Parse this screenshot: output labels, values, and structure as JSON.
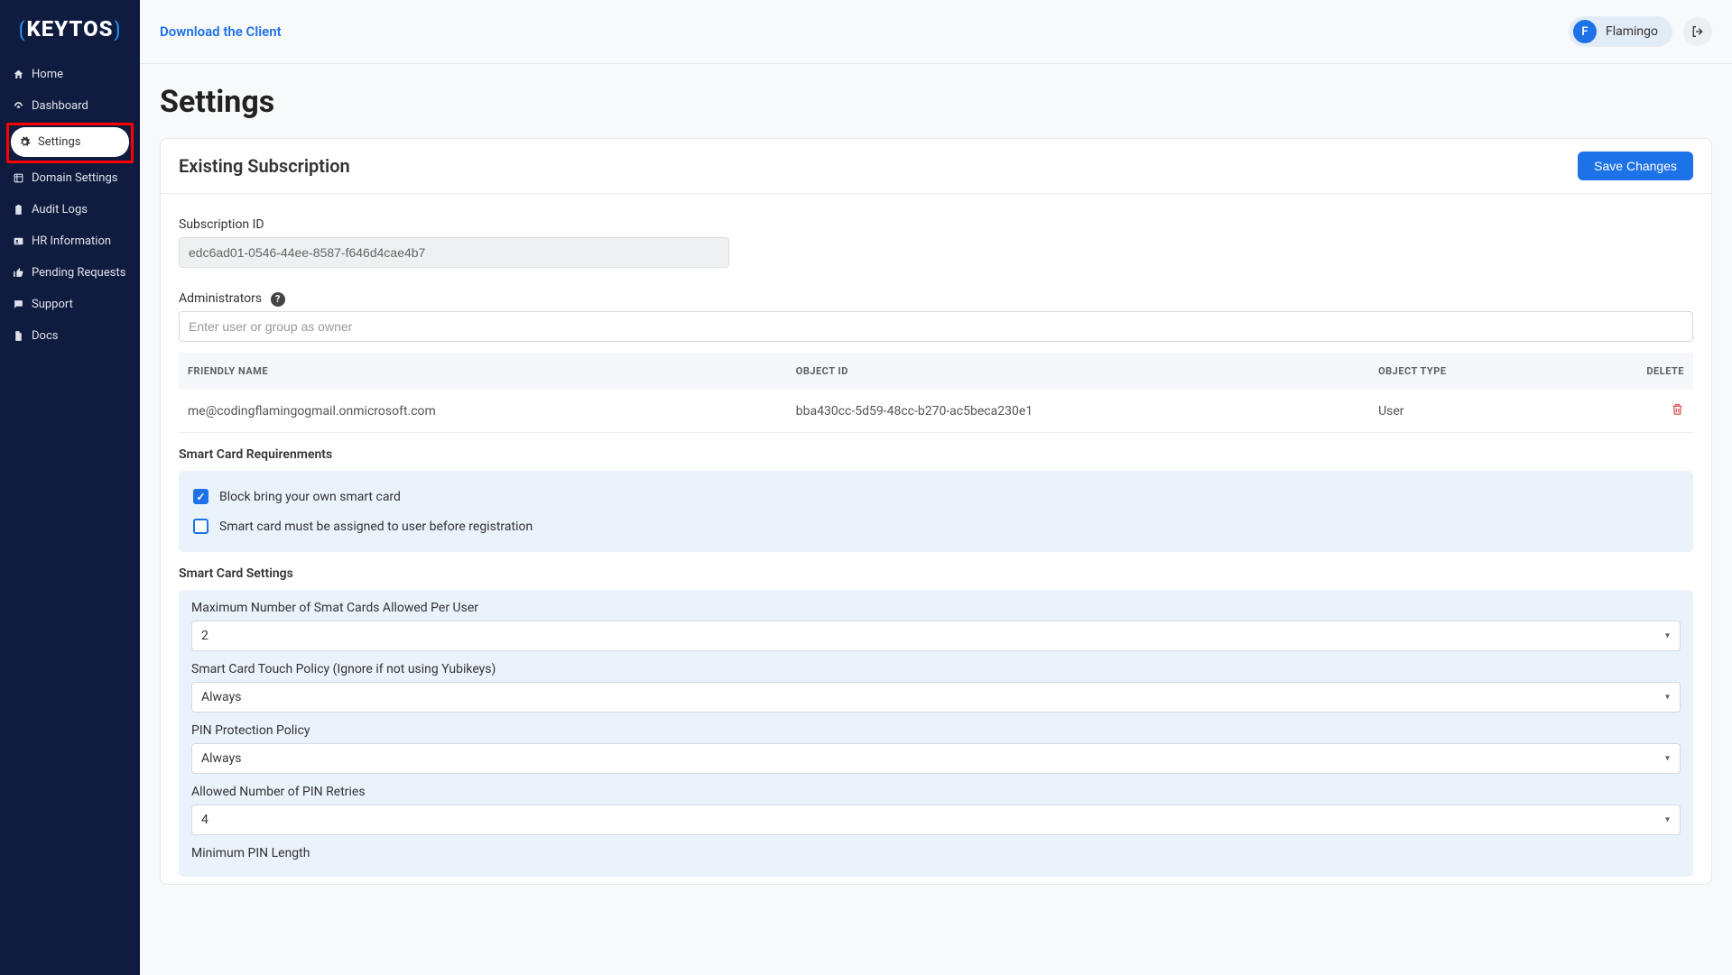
{
  "brand": {
    "name": "KEYTOS"
  },
  "sidebar": {
    "items": [
      {
        "label": "Home",
        "icon": "home-icon"
      },
      {
        "label": "Dashboard",
        "icon": "gauge-icon"
      },
      {
        "label": "Settings",
        "icon": "gear-icon"
      },
      {
        "label": "Domain Settings",
        "icon": "globe-icon"
      },
      {
        "label": "Audit Logs",
        "icon": "clipboard-icon"
      },
      {
        "label": "HR Information",
        "icon": "id-icon"
      },
      {
        "label": "Pending Requests",
        "icon": "thumb-icon"
      },
      {
        "label": "Support",
        "icon": "chat-icon"
      },
      {
        "label": "Docs",
        "icon": "file-icon"
      }
    ]
  },
  "header": {
    "download_link": "Download the Client",
    "user_initial": "F",
    "user_name": "Flamingo"
  },
  "page": {
    "title": "Settings"
  },
  "subscription": {
    "card_title": "Existing Subscription",
    "save_label": "Save Changes",
    "id_label": "Subscription ID",
    "id_value": "edc6ad01-0546-44ee-8587-f646d4cae4b7",
    "admins_label": "Administrators",
    "admins_placeholder": "Enter user or group as owner",
    "table": {
      "cols": {
        "friendly": "FRIENDLY NAME",
        "oid": "OBJECT ID",
        "otype": "OBJECT TYPE",
        "del": "DELETE"
      },
      "rows": [
        {
          "friendly": "me@codingflamingogmail.onmicrosoft.com",
          "oid": "bba430cc-5d59-48cc-b270-ac5beca230e1",
          "otype": "User"
        }
      ]
    },
    "smartcard_req": {
      "title": "Smart Card Requirenments",
      "block_label": "Block bring your own smart card",
      "block_checked": true,
      "assign_label": "Smart card must be assigned to user before registration",
      "assign_checked": false
    },
    "smartcard_settings": {
      "title": "Smart Card Settings",
      "max_label": "Maximum Number of Smat Cards Allowed Per User",
      "max_value": "2",
      "touch_label": "Smart Card Touch Policy (Ignore if not using Yubikeys)",
      "touch_value": "Always",
      "pin_policy_label": "PIN Protection Policy",
      "pin_policy_value": "Always",
      "pin_retries_label": "Allowed Number of PIN Retries",
      "pin_retries_value": "4",
      "min_pin_label": "Minimum PIN Length"
    }
  }
}
